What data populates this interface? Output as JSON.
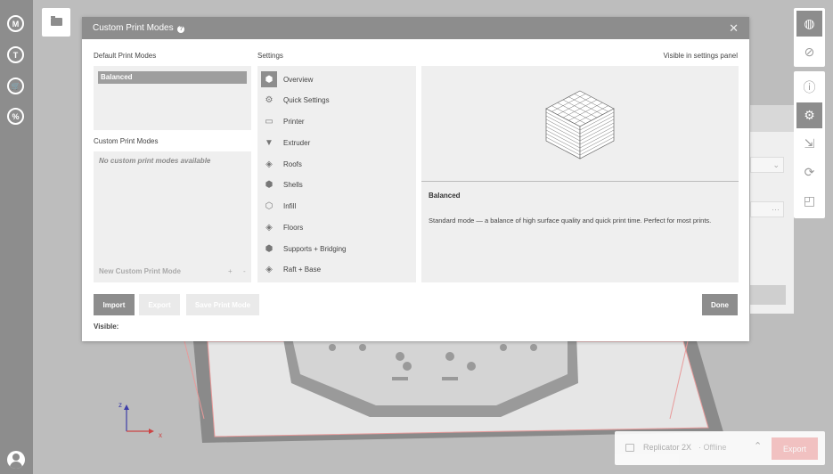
{
  "app": {
    "nav_icons": [
      {
        "name": "makerbot-logo-icon",
        "glyph": "M"
      },
      {
        "name": "thingiverse-icon",
        "glyph": "T"
      },
      {
        "name": "store-cart-icon",
        "glyph": "🛒"
      },
      {
        "name": "discount-icon",
        "glyph": "%"
      }
    ]
  },
  "dialog": {
    "title": "Custom Print Modes",
    "help_glyph": "?",
    "close_glyph": "✕",
    "visible_in_settings": "Visible in settings panel",
    "default_label": "Default Print Modes",
    "default_modes": [
      "Balanced"
    ],
    "custom_label": "Custom Print Modes",
    "custom_empty": "No custom print modes available",
    "new_custom": "New Custom Print Mode",
    "plus": "+",
    "minus": "-",
    "settings_label": "Settings",
    "settings_items": [
      {
        "label": "Overview",
        "icon": "cube-icon",
        "glyph": "⬢"
      },
      {
        "label": "Quick Settings",
        "icon": "gear-icon",
        "glyph": "⚙"
      },
      {
        "label": "Printer",
        "icon": "printer-window-icon",
        "glyph": "▭"
      },
      {
        "label": "Extruder",
        "icon": "extruder-icon",
        "glyph": "▼"
      },
      {
        "label": "Roofs",
        "icon": "roofs-icon",
        "glyph": "◈"
      },
      {
        "label": "Shells",
        "icon": "shells-icon",
        "glyph": "⬢"
      },
      {
        "label": "Infill",
        "icon": "infill-icon",
        "glyph": "⬡"
      },
      {
        "label": "Floors",
        "icon": "floors-icon",
        "glyph": "◈"
      },
      {
        "label": "Supports + Bridging",
        "icon": "supports-icon",
        "glyph": "⬢"
      },
      {
        "label": "Raft + Base",
        "icon": "raft-icon",
        "glyph": "◈"
      }
    ],
    "mode_title": "Balanced",
    "mode_desc": "Standard mode — a balance of high surface quality and quick print time. Perfect for most prints.",
    "buttons": {
      "import": "Import",
      "export": "Export",
      "save": "Save Print Mode",
      "done": "Done"
    },
    "visible_label": "Visible:"
  },
  "right_toolbar": {
    "more_glyph": "···"
  },
  "printer_bar": {
    "name": "Replicator 2X",
    "status": "· Offline",
    "chevron": "⌃",
    "export": "Export"
  },
  "axes": {
    "x": "x",
    "z": "z"
  }
}
